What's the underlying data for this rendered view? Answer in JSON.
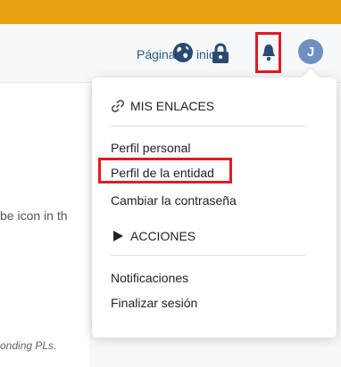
{
  "navbar": {
    "home_link": "Página de inicio",
    "icons": [
      "globe-icon",
      "lock-icon",
      "bell-icon"
    ],
    "avatar_letter": "J"
  },
  "dropdown": {
    "links_section": {
      "title": "MIS ENLACES",
      "items": [
        "Perfil personal",
        "Perfil de la entidad",
        "Cambiar la contraseña"
      ]
    },
    "actions_section": {
      "title": "ACCIONES",
      "items": [
        "Notificaciones",
        "Finalizar sesión"
      ]
    }
  },
  "background": {
    "text_fragment": "be icon in th",
    "footer_fragment": "onding PLs."
  },
  "colors": {
    "top_strip": "#e8a010",
    "link": "#2a5b8c",
    "avatar": "#6f8fc2",
    "highlight": "#e01b24"
  }
}
